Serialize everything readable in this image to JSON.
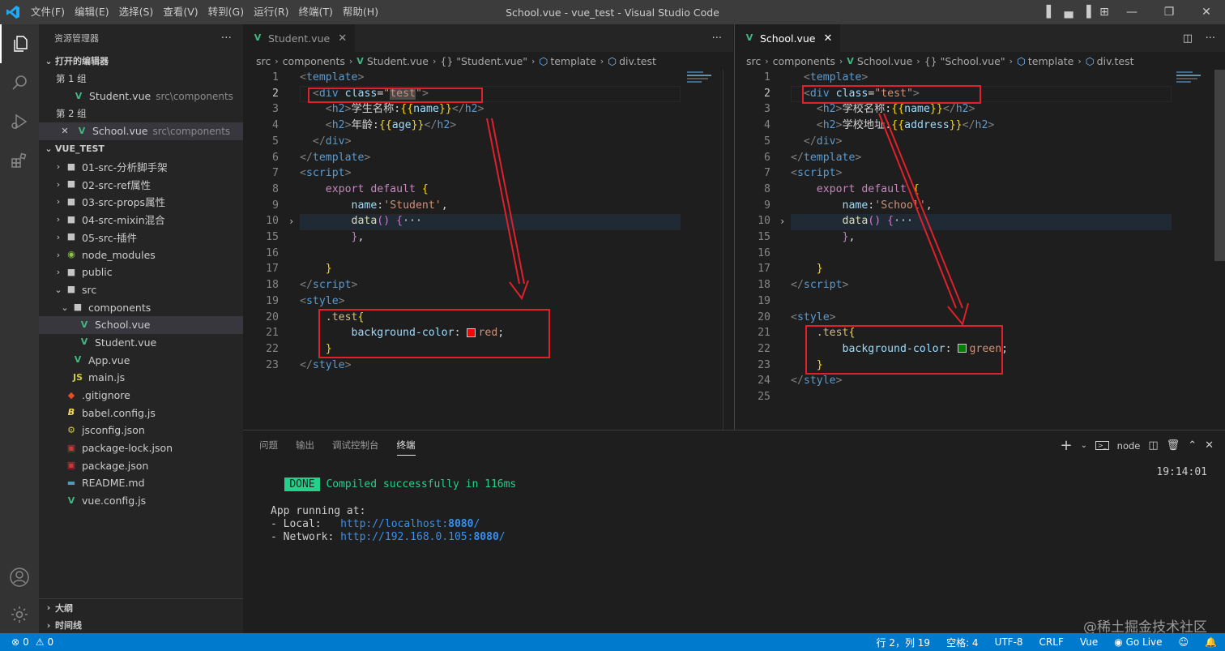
{
  "titlebar": {
    "menu": [
      "文件(F)",
      "编辑(E)",
      "选择(S)",
      "查看(V)",
      "转到(G)",
      "运行(R)",
      "终端(T)",
      "帮助(H)"
    ],
    "title": "School.vue - vue_test - Visual Studio Code"
  },
  "sidebar": {
    "header": "资源管理器",
    "open_editors_title": "打开的编辑器",
    "group1": "第 1 组",
    "group1_file": "Student.vue",
    "group1_path": "src\\components",
    "group2": "第 2 组",
    "group2_file": "School.vue",
    "group2_path": "src\\components",
    "project_title": "VUE_TEST",
    "tree": [
      {
        "label": "01-src-分析脚手架"
      },
      {
        "label": "02-src-ref属性"
      },
      {
        "label": "03-src-props属性"
      },
      {
        "label": "04-src-mixin混合"
      },
      {
        "label": "05-src-插件"
      },
      {
        "label": "node_modules"
      },
      {
        "label": "public"
      },
      {
        "label": "src"
      },
      {
        "label": "components"
      },
      {
        "label": "School.vue"
      },
      {
        "label": "Student.vue"
      },
      {
        "label": "App.vue"
      },
      {
        "label": "main.js"
      },
      {
        "label": ".gitignore"
      },
      {
        "label": "babel.config.js"
      },
      {
        "label": "jsconfig.json"
      },
      {
        "label": "package-lock.json"
      },
      {
        "label": "package.json"
      },
      {
        "label": "README.md"
      },
      {
        "label": "vue.config.js"
      }
    ],
    "outline": "大纲",
    "timeline": "时间线"
  },
  "left_editor": {
    "tab": "Student.vue",
    "crumbs": [
      "src",
      "components",
      "Student.vue",
      "{} \"Student.vue\"",
      "template",
      "div.test"
    ],
    "line_numbers": [
      "1",
      "2",
      "3",
      "4",
      "5",
      "6",
      "7",
      "8",
      "9",
      "10",
      "15",
      "16",
      "17",
      "18",
      "19",
      "20",
      "21",
      "22",
      "23"
    ]
  },
  "right_editor": {
    "tab": "School.vue",
    "crumbs": [
      "src",
      "components",
      "School.vue",
      "{} \"School.vue\"",
      "template",
      "div.test"
    ],
    "line_numbers": [
      "1",
      "2",
      "3",
      "4",
      "5",
      "6",
      "7",
      "8",
      "9",
      "10",
      "15",
      "16",
      "17",
      "18",
      "19",
      "20",
      "21",
      "22",
      "23",
      "24",
      "25"
    ]
  },
  "panel": {
    "tabs": [
      "问题",
      "输出",
      "调试控制台",
      "终端"
    ],
    "terminal_name": "node",
    "done_badge": "DONE",
    "compiled": "Compiled successfully in 116ms",
    "time": "19:14:01",
    "running": "App running at:",
    "local_label": "- Local:   ",
    "local_url": "http://localhost:",
    "local_port": "8080",
    "network_label": "- Network: ",
    "network_url": "http://192.168.0.105:",
    "network_port": "8080"
  },
  "statusbar": {
    "errors": "0",
    "warnings": "0",
    "position": "行 2，列 19",
    "spaces": "空格: 4",
    "encoding": "UTF-8",
    "eol": "CRLF",
    "language": "Vue",
    "golive": "Go Live"
  },
  "watermark": "@稀土掘金技术社区",
  "colors": {
    "accent": "#007acc",
    "annotation": "#e0202a",
    "red_swatch": "#ff0000",
    "green_swatch": "#008000"
  }
}
